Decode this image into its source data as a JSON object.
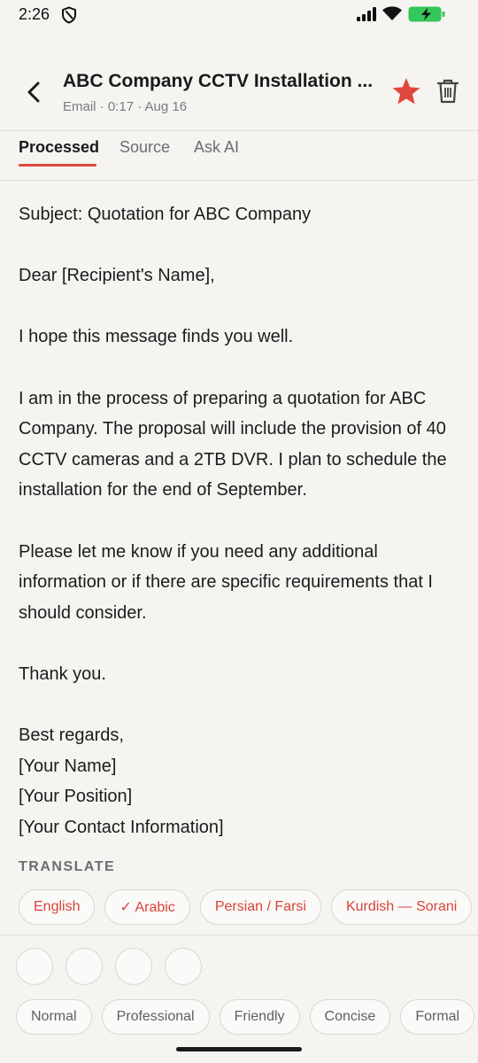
{
  "status_bar": {
    "time": "2:26"
  },
  "header": {
    "title": "ABC Company CCTV Installation ...",
    "meta": "Email · 0:17 · Aug 16"
  },
  "colors": {
    "accent": "#e0483e",
    "battery": "#34c759"
  },
  "tabs": [
    {
      "label": "Processed",
      "active": true
    },
    {
      "label": "Source",
      "active": false
    },
    {
      "label": "Ask AI",
      "active": false
    }
  ],
  "email": {
    "subject": "Subject: Quotation for ABC Company",
    "greeting": "Dear [Recipient's Name],",
    "paragraph1": "I hope this message finds you well.",
    "paragraph2": "I am in the process of preparing a quotation for ABC Company. The proposal will include the provision of 40 CCTV cameras and a 2TB DVR. I plan to schedule the installation for the end of September.",
    "paragraph3": "Please let me know if you need any additional information or if there are specific requirements that I should consider.",
    "paragraph4": "Thank you.",
    "closing": "Best regards,",
    "name": "[Your Name]",
    "position": "[Your Position]",
    "contact": "[Your Contact Information]"
  },
  "translate": {
    "label": "TRANSLATE",
    "languages": [
      {
        "label": "English",
        "selected": false
      },
      {
        "label": "✓ Arabic",
        "selected": true
      },
      {
        "label": "Persian / Farsi",
        "selected": false
      },
      {
        "label": "Kurdish — Sorani",
        "selected": false
      }
    ]
  },
  "tones": [
    "Normal",
    "Professional",
    "Friendly",
    "Concise",
    "Formal"
  ],
  "icons": [
    "back-arrow-icon",
    "star-icon",
    "trash-icon",
    "shield-icon",
    "signal-icon",
    "wifi-icon",
    "battery-icon"
  ]
}
